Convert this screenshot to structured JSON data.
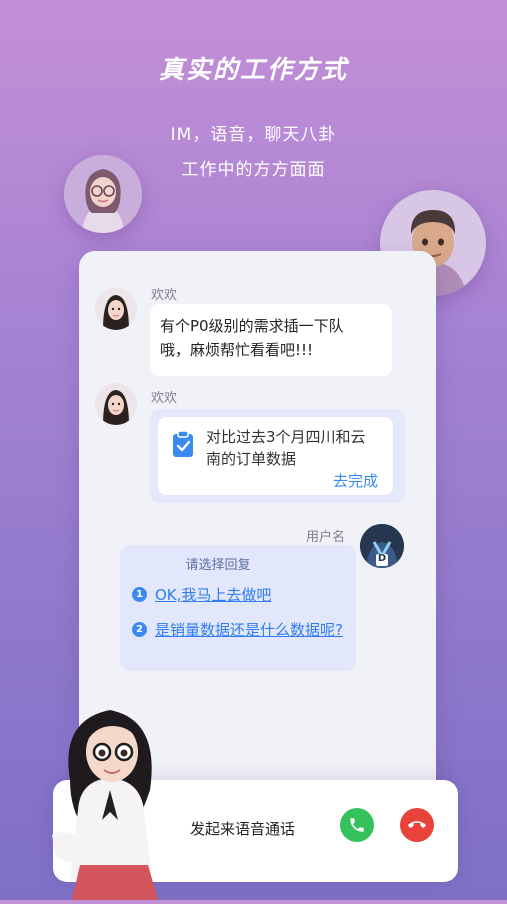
{
  "header": {
    "title": "真实的工作方式",
    "subtitle_line1": "IM，语音，聊天八卦",
    "subtitle_line2": "工作中的方方面面"
  },
  "chat": {
    "message1": {
      "sender": "欢欢",
      "text_line1": "有个P0级别的需求插一下队",
      "text_line2": "哦，麻烦帮忙看看吧!!!"
    },
    "message2": {
      "sender": "欢欢",
      "task_line1": "对比过去3个月四川和云",
      "task_line2": "南的订单数据",
      "action": "去完成",
      "icon": "clipboard-check-icon"
    },
    "user": {
      "name": "用户名",
      "badge_letter": "D"
    },
    "reply": {
      "prompt": "请选择回复",
      "options": [
        {
          "num": "1",
          "text": "OK,我马上去做吧"
        },
        {
          "num": "2",
          "text": "是销量数据还是什么数据呢?"
        }
      ]
    }
  },
  "call": {
    "label": "发起来语音通话",
    "accept_color": "#35c25d",
    "decline_color": "#e8423b"
  }
}
